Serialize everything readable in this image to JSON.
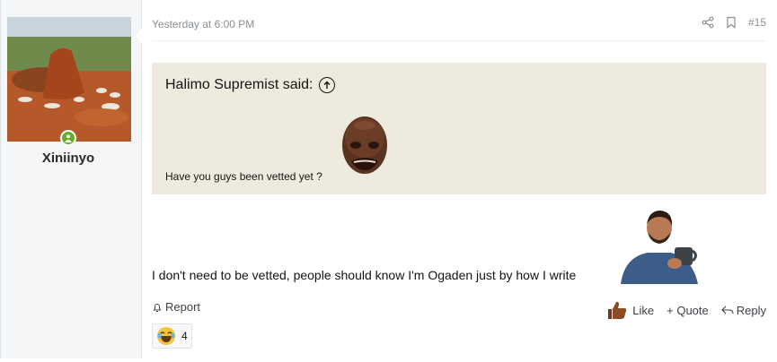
{
  "user": {
    "name": "Xiniinyo",
    "online": true
  },
  "post": {
    "date": "Yesterday at 6:00 PM",
    "number": "#15",
    "quote": {
      "author_line": "Halimo Supremist said:",
      "text": "Have you guys been vetted yet ?"
    },
    "body": "I don't need to be vetted, people should know I'm Ogaden just by how I write"
  },
  "actions": {
    "report": "Report",
    "like": "Like",
    "quote": "+ Quote",
    "reply": "Reply"
  },
  "reactions": {
    "count": "4",
    "icon": "laughing-emoji-icon"
  },
  "colors": {
    "quote_bg": "#eeebde",
    "online": "#63b12b",
    "sidebar_bg": "#f5f6f8"
  }
}
